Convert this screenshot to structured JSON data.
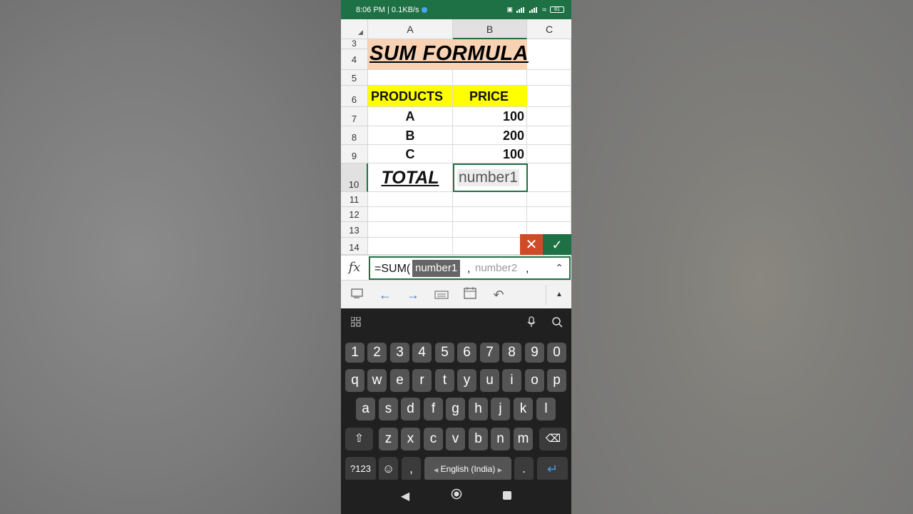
{
  "status_bar": {
    "time_speed": "8:06 PM | 0.1KB/s",
    "battery": "81"
  },
  "columns": [
    "A",
    "B",
    "C"
  ],
  "rows": [
    "3",
    "4",
    "5",
    "6",
    "7",
    "8",
    "9",
    "10",
    "11",
    "12",
    "13",
    "14"
  ],
  "sheet": {
    "title": "SUM FORMULA",
    "header_products": "PRODUCTS",
    "header_price": "PRICE",
    "products": [
      "A",
      "B",
      "C"
    ],
    "prices": [
      "100",
      "200",
      "100"
    ],
    "total_label": "TOTAL",
    "active_cell_hint": "number1"
  },
  "formula_bar": {
    "fx": "fx",
    "prefix": "=SUM(",
    "arg1": "number1",
    "arg2": "number2",
    "comma": ","
  },
  "keyboard": {
    "row_numbers": [
      "1",
      "2",
      "3",
      "4",
      "5",
      "6",
      "7",
      "8",
      "9",
      "0"
    ],
    "row_q": [
      "q",
      "w",
      "e",
      "r",
      "t",
      "y",
      "u",
      "i",
      "o",
      "p"
    ],
    "row_a": [
      "a",
      "s",
      "d",
      "f",
      "g",
      "h",
      "j",
      "k",
      "l"
    ],
    "row_z": [
      "z",
      "x",
      "c",
      "v",
      "b",
      "n",
      "m"
    ],
    "key_123": "?123",
    "key_comma": ",",
    "space_label": "English (India)",
    "key_period": "."
  },
  "colors": {
    "excel_green": "#1e7145",
    "title_fill": "#f9d2b4",
    "header_fill": "#ffff00",
    "cancel_red": "#d04a27"
  }
}
